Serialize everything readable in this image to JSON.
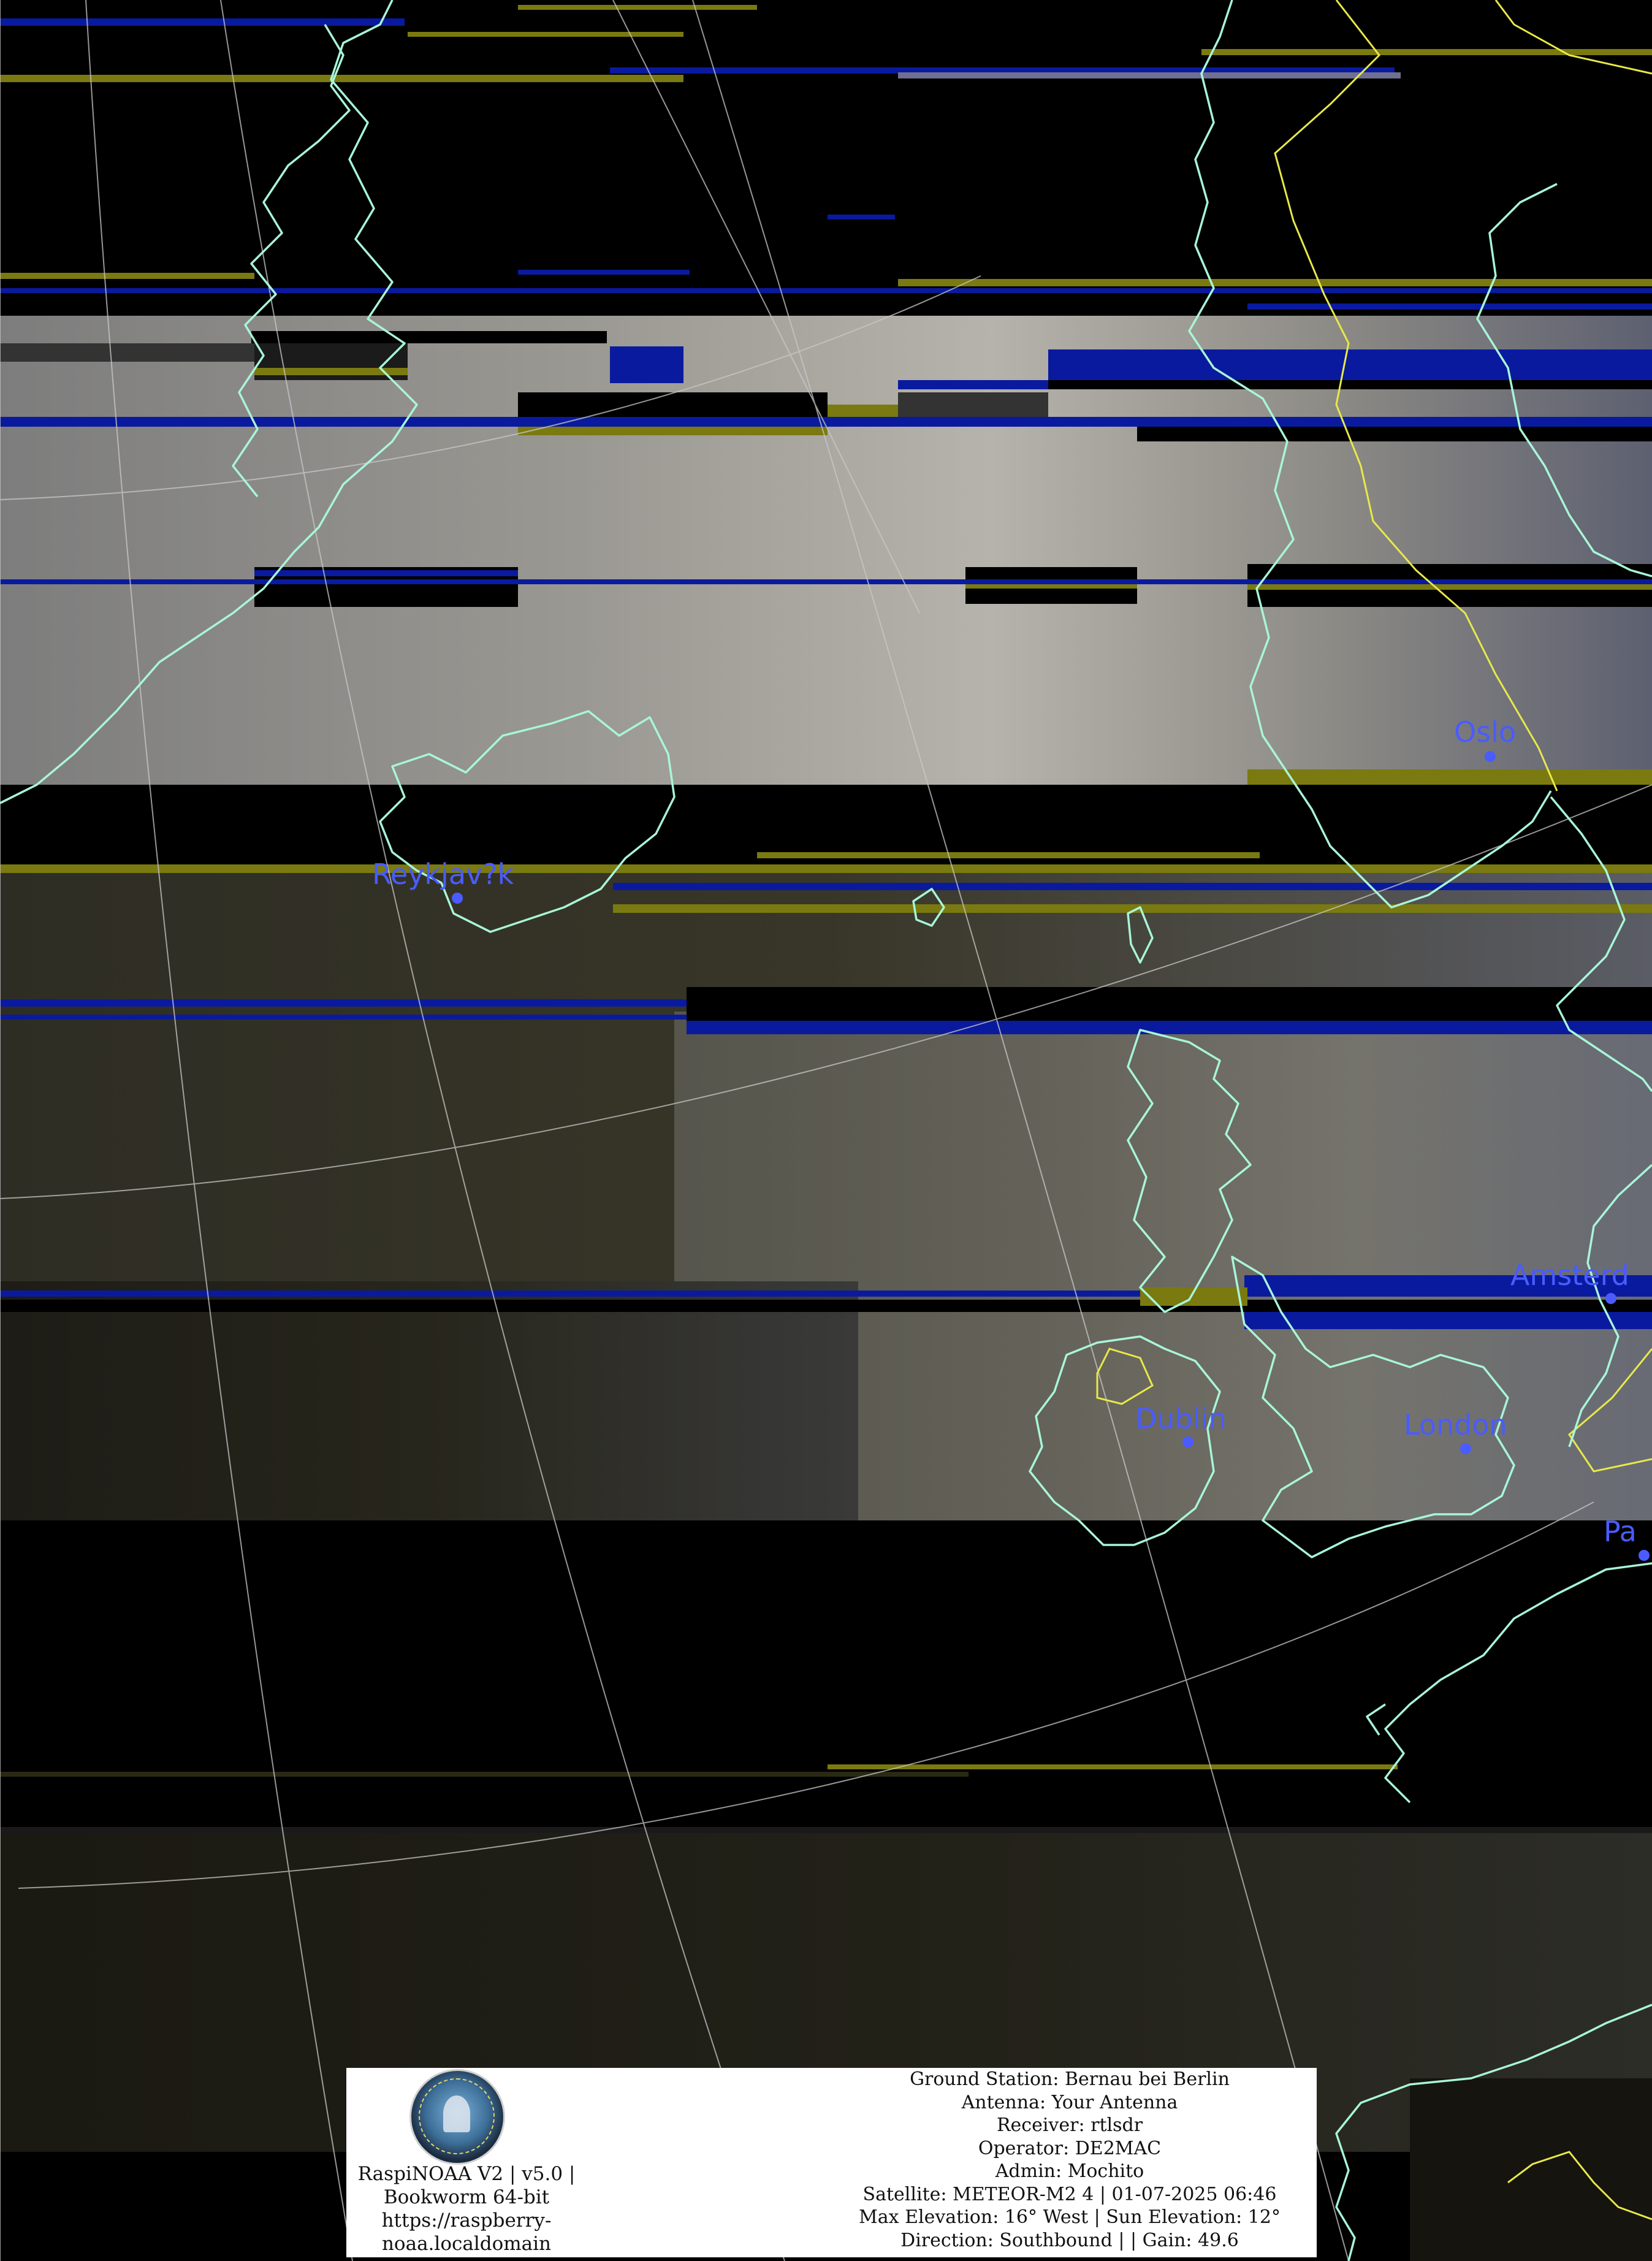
{
  "map": {
    "cities": [
      {
        "name": "Oslo"
      },
      {
        "name": "Reykjav?k"
      },
      {
        "name": "Amsterd"
      },
      {
        "name": "Dublin"
      },
      {
        "name": "London"
      },
      {
        "name": "Pa"
      }
    ],
    "colors": {
      "coastline": "#a8f5d8",
      "border": "#e8e84a",
      "grid": "#c8c8c8",
      "city": "#4a5cff",
      "noise_blue": "#0a1a9e",
      "noise_yellow": "#7a7a10"
    }
  },
  "station": {
    "logo_icon": "raspinoaa-logo-icon",
    "brand_lines": [
      "RaspiNOAA V2 | v5.0 |",
      "Bookworm 64-bit",
      "https://raspberry-",
      "noaa.localdomain"
    ],
    "details": [
      "Ground Station: Bernau bei Berlin",
      "Antenna: Your Antenna",
      "Receiver: rtlsdr",
      "Operator: DE2MAC",
      "Admin: Mochito",
      "Satellite: METEOR-M2 4 | 01-07-2025 06:46",
      "Max Elevation: 16° West | Sun Elevation: 12°",
      "Direction: Southbound | | Gain: 49.6"
    ]
  }
}
